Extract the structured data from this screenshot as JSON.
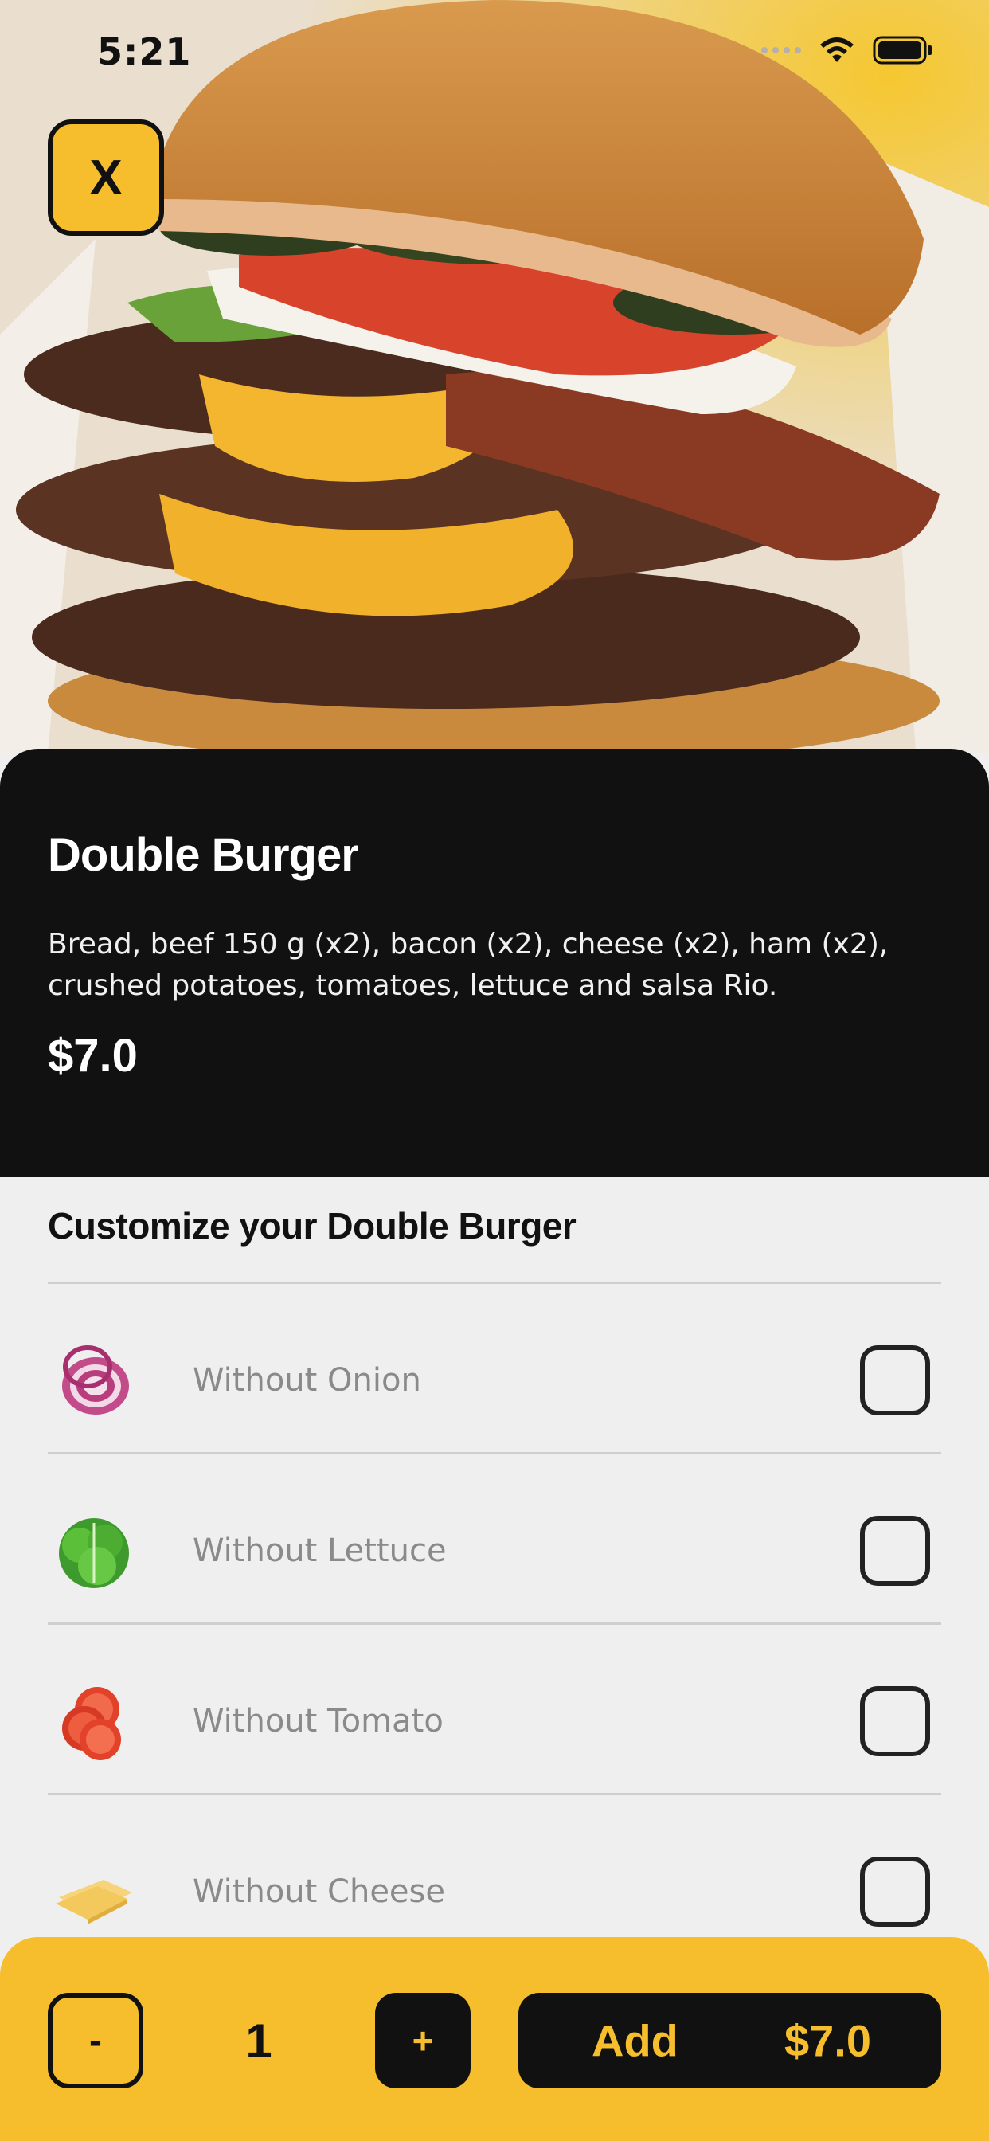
{
  "status_bar": {
    "time": "5:21"
  },
  "header": {
    "close_label": "X"
  },
  "product": {
    "title": "Double Burger",
    "description": "Bread, beef 150 g (x2), bacon (x2), cheese (x2), ham (x2), crushed potatoes, tomatoes, lettuce and salsa Rio.",
    "price": "$7.0"
  },
  "customize": {
    "title": "Customize your Double Burger",
    "options": [
      {
        "label": "Without Onion",
        "icon": "onion-icon",
        "checked": false
      },
      {
        "label": "Without Lettuce",
        "icon": "lettuce-icon",
        "checked": false
      },
      {
        "label": "Without Tomato",
        "icon": "tomato-icon",
        "checked": false
      },
      {
        "label": "Without Cheese",
        "icon": "cheese-icon",
        "checked": false
      }
    ]
  },
  "order_bar": {
    "minus_label": "-",
    "quantity": "1",
    "plus_label": "+",
    "add_label": "Add",
    "add_price": "$7.0"
  },
  "colors": {
    "accent": "#f6bd2c",
    "dark": "#111111",
    "background": "#efefef"
  }
}
